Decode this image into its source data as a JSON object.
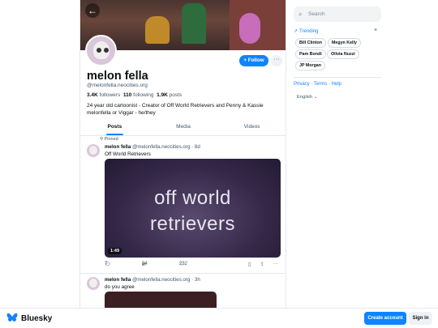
{
  "profile": {
    "display_name": "melon fella",
    "handle": "@melonfella.neocities.org",
    "followers_count": "3.4K",
    "followers_label": "followers",
    "following_count": "110",
    "following_label": "following",
    "posts_count": "1.9K",
    "posts_label": "posts",
    "bio": "24 year old cartoonist - Creator of Off World Retrievers and Penny & Kassie melonfella or Viggar - he/they",
    "follow_label": "+ Follow",
    "more_label": "···",
    "back_icon": "arrow-left-icon"
  },
  "tabs": [
    {
      "label": "Posts",
      "active": true
    },
    {
      "label": "Media",
      "active": false
    },
    {
      "label": "Videos",
      "active": false
    }
  ],
  "posts": [
    {
      "pinned_label": "Pinned",
      "author": "melon fella",
      "handle": "@melonfella.neocities.org",
      "time": "· 8d",
      "text": "Off World Retrievers",
      "video_title_line1": "off world",
      "video_title_line2": "retrievers",
      "video_duration": "1:49",
      "replies": "7",
      "reposts": "84",
      "likes": "232"
    },
    {
      "author": "melon fella",
      "handle": "@melonfella.neocities.org",
      "time": "· 3h",
      "text": "do you agree"
    }
  ],
  "sidebar": {
    "search_placeholder": "Search",
    "trending_label": "Trending",
    "trending_close": "×",
    "trending_items": [
      "Bill Clinton",
      "Megyn Kelly",
      "Pam Bondi",
      "Olivia Nuzzi",
      "JP Morgan"
    ],
    "links": "Privacy · Terms · Help",
    "language": "English"
  },
  "bottom": {
    "brand": "Bluesky",
    "create_account": "Create account",
    "sign_in": "Sign in"
  },
  "colors": {
    "accent": "#1083fe",
    "text_secondary": "#42576c",
    "border": "#e3e8ee"
  }
}
